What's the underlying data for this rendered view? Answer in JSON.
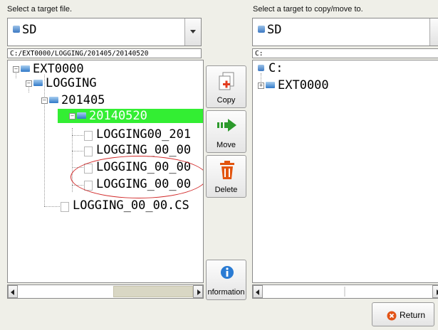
{
  "left": {
    "label": "Select a target file.",
    "drive": "SD",
    "path": "C:/EXT0000/LOGGING/201405/20140520",
    "tree": [
      "EXT0000",
      "LOGGING",
      "201405",
      "20140520",
      "LOGGING00_201",
      "LOGGING_00_00",
      "LOGGING_00_00",
      "LOGGING_00_00",
      "LOGGING_00_00.CS"
    ],
    "selected_color": "#33ee33",
    "annotation_color": "#d22b2b"
  },
  "buttons": {
    "copy": "Copy",
    "move": "Move",
    "delete": "Delete",
    "information": "nformation"
  },
  "right": {
    "label": "Select a target to copy/move to.",
    "drive": "SD",
    "path": "C:",
    "tree": [
      "C:",
      "EXT0000"
    ]
  },
  "return_label": "Return"
}
